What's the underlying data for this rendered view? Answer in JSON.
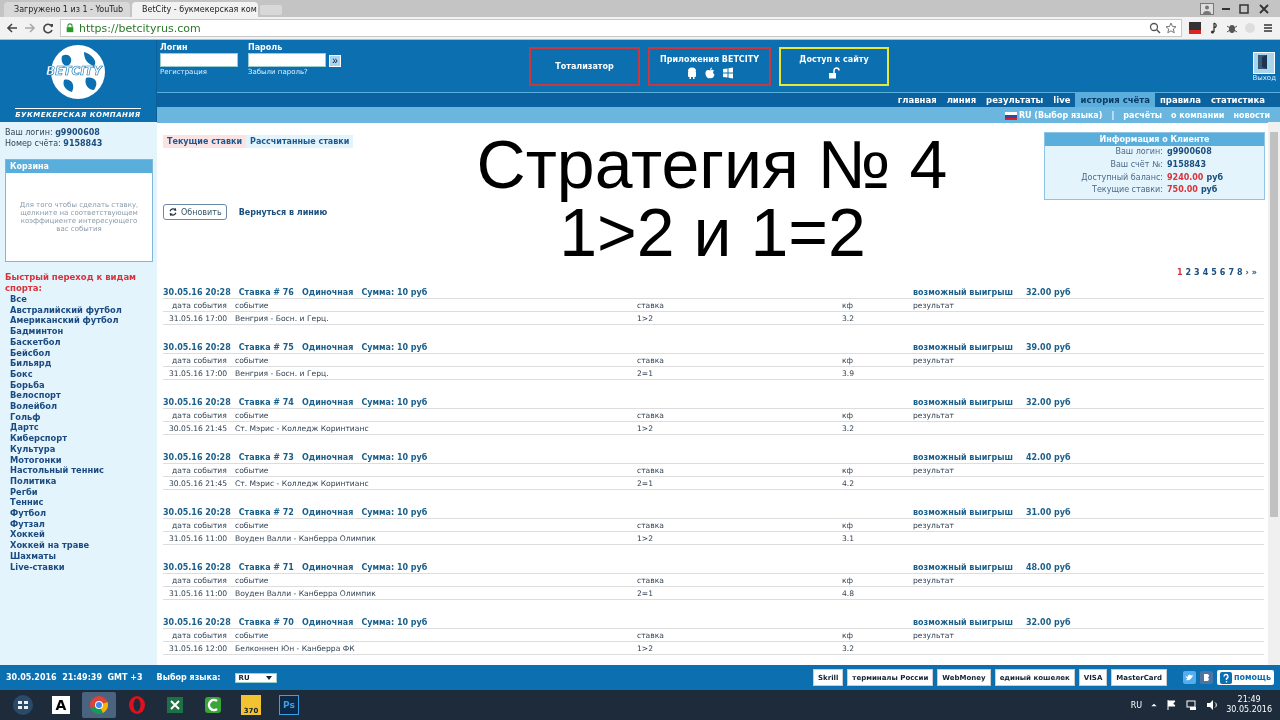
{
  "browser": {
    "tabs": [
      {
        "title": "Загружено 1 из 1 - YouTub",
        "selected": false
      },
      {
        "title": "BetCity - букмекерская ком",
        "selected": true
      }
    ],
    "url": "https://betcityrus.com"
  },
  "header": {
    "logo": {
      "name": "BETCITY",
      "tagline": "БУКМЕКЕРСКАЯ КОМПАНИЯ"
    },
    "login": {
      "label": "Логин",
      "link": "Регистрация"
    },
    "password": {
      "label": "Пароль",
      "link": "Забыли пароль?"
    },
    "submit": "»",
    "promo": [
      {
        "kind": "plain",
        "title": "Тотализатор",
        "color": "#c8383e"
      },
      {
        "kind": "apps",
        "title": "Приложения BETCITY",
        "color": "#c8383e"
      },
      {
        "kind": "lock",
        "title": "Доступ к сайту",
        "color": "#e8e83a"
      }
    ],
    "exit": "Выход"
  },
  "nav": [
    {
      "label": "главная",
      "selected": false
    },
    {
      "label": "линия",
      "selected": false
    },
    {
      "label": "результаты",
      "selected": false
    },
    {
      "label": "live",
      "selected": false
    },
    {
      "label": "история счёта",
      "selected": true
    },
    {
      "label": "правила",
      "selected": false
    },
    {
      "label": "статистика",
      "selected": false
    }
  ],
  "subnav": {
    "language": "RU (Выбор языка)",
    "separator": "|",
    "links": [
      "расчёты",
      "о компании",
      "новости"
    ]
  },
  "account": {
    "login_label": "Ваш логин:",
    "login": "g9900608",
    "number_label": "Номер счёта:",
    "number": "9158843"
  },
  "basket": {
    "title": "Корзина",
    "hint": "Для того чтобы сделать ставку, щелкните на соответствующем коэффициенте интересующего вас события"
  },
  "sports": {
    "heading": "Быстрый переход к видам спорта:",
    "items": [
      "Все",
      "Австралийский футбол",
      "Американский футбол",
      "Бадминтон",
      "Баскетбол",
      "Бейсбол",
      "Бильярд",
      "Бокс",
      "Борьба",
      "Велоспорт",
      "Волейбол",
      "Гольф",
      "Дартс",
      "Киберспорт",
      "Культура",
      "Мотогонки",
      "Настольный теннис",
      "Политика",
      "Регби",
      "Теннис",
      "Футбол",
      "Футзал",
      "Хоккей",
      "Хоккей на траве",
      "Шахматы",
      "Live-ставки"
    ]
  },
  "bet_tabs": [
    {
      "label": "Текущие ставки",
      "selected": true
    },
    {
      "label": "Рассчитанные ставки",
      "selected": false
    }
  ],
  "refresh": "Обновить",
  "back_link": "Вернуться в линию",
  "overlay": [
    "Стратегия № 4",
    "1>2 и 1=2"
  ],
  "client_info": {
    "title": "Информация о Клиенте",
    "rows": [
      {
        "label": "Ваш логин:",
        "value": "g9900608"
      },
      {
        "label": "Ваш счёт №:",
        "value": "9158843"
      },
      {
        "label": "Доступный баланс:",
        "value": "9240.00",
        "unit": "руб"
      },
      {
        "label": "Текущие ставки:",
        "value": "750.00",
        "unit": "руб"
      }
    ]
  },
  "pagination": [
    {
      "label": "1",
      "selected": true
    },
    {
      "label": "2",
      "selected": false
    },
    {
      "label": "3",
      "selected": false
    },
    {
      "label": "4",
      "selected": false
    },
    {
      "label": "5",
      "selected": false
    },
    {
      "label": "6",
      "selected": false
    },
    {
      "label": "7",
      "selected": false
    },
    {
      "label": "8",
      "selected": false
    },
    {
      "label": "›",
      "selected": false
    },
    {
      "label": "»",
      "selected": false
    }
  ],
  "bets": [
    {
      "placed": "30.05.16 20:28",
      "number": "Ставка # 76",
      "type": "Одиночная",
      "sum": "Сумма: 10 руб",
      "win_label": "возможный выигрыш",
      "win": "32.00 руб",
      "columns": [
        "дата события",
        "событие",
        "ставка",
        "кф",
        "результат"
      ],
      "event_date": "31.05.16 17:00",
      "event": "Венгрия - Босн. и Герц.",
      "pick": "1>2",
      "odds": "3.2"
    },
    {
      "placed": "30.05.16 20:28",
      "number": "Ставка # 75",
      "type": "Одиночная",
      "sum": "Сумма: 10 руб",
      "win_label": "возможный выигрыш",
      "win": "39.00 руб",
      "columns": [
        "дата события",
        "событие",
        "ставка",
        "кф",
        "результат"
      ],
      "event_date": "31.05.16 17:00",
      "event": "Венгрия - Босн. и Герц.",
      "pick": "2=1",
      "odds": "3.9"
    },
    {
      "placed": "30.05.16 20:28",
      "number": "Ставка # 74",
      "type": "Одиночная",
      "sum": "Сумма: 10 руб",
      "win_label": "возможный выигрыш",
      "win": "32.00 руб",
      "columns": [
        "дата события",
        "событие",
        "ставка",
        "кф",
        "результат"
      ],
      "event_date": "30.05.16 21:45",
      "event": "Ст. Мэрис - Колледж Коринтианс",
      "pick": "1>2",
      "odds": "3.2"
    },
    {
      "placed": "30.05.16 20:28",
      "number": "Ставка # 73",
      "type": "Одиночная",
      "sum": "Сумма: 10 руб",
      "win_label": "возможный выигрыш",
      "win": "42.00 руб",
      "columns": [
        "дата события",
        "событие",
        "ставка",
        "кф",
        "результат"
      ],
      "event_date": "30.05.16 21:45",
      "event": "Ст. Мэрис - Колледж Коринтианс",
      "pick": "2=1",
      "odds": "4.2"
    },
    {
      "placed": "30.05.16 20:28",
      "number": "Ставка # 72",
      "type": "Одиночная",
      "sum": "Сумма: 10 руб",
      "win_label": "возможный выигрыш",
      "win": "31.00 руб",
      "columns": [
        "дата события",
        "событие",
        "ставка",
        "кф",
        "результат"
      ],
      "event_date": "31.05.16 11:00",
      "event": "Воуден Валли - Канберра Олимпик",
      "pick": "1>2",
      "odds": "3.1"
    },
    {
      "placed": "30.05.16 20:28",
      "number": "Ставка # 71",
      "type": "Одиночная",
      "sum": "Сумма: 10 руб",
      "win_label": "возможный выигрыш",
      "win": "48.00 руб",
      "columns": [
        "дата события",
        "событие",
        "ставка",
        "кф",
        "результат"
      ],
      "event_date": "31.05.16 11:00",
      "event": "Воуден Валли - Канберра Олимпик",
      "pick": "2=1",
      "odds": "4.8"
    },
    {
      "placed": "30.05.16 20:28",
      "number": "Ставка # 70",
      "type": "Одиночная",
      "sum": "Сумма: 10 руб",
      "win_label": "возможный выигрыш",
      "win": "32.00 руб",
      "columns": [
        "дата события",
        "событие",
        "ставка",
        "кф",
        "результат"
      ],
      "event_date": "31.05.16 12:00",
      "event": "Белконнен Юн - Канберра ФК",
      "pick": "1>2",
      "odds": "3.2"
    }
  ],
  "footer": {
    "datetime": "30.05.2016  21:49:39  GMT +3",
    "language_label": "Выбор языка:",
    "language": "RU",
    "payments": [
      "Skrill",
      "терминалы России",
      "WebMoney",
      "единый кошелек",
      "VISA",
      "MasterCard"
    ],
    "help": "помощь"
  },
  "taskbar": {
    "apps": [
      {
        "kind": "letter",
        "glyph": "A",
        "selected": false
      },
      {
        "kind": "chrome",
        "selected": true
      },
      {
        "kind": "opera",
        "selected": false
      },
      {
        "kind": "excel",
        "selected": false
      },
      {
        "kind": "camtasia",
        "selected": false
      },
      {
        "kind": "clapper",
        "glyph": "370",
        "selected": false
      },
      {
        "kind": "ps",
        "glyph": "Ps",
        "selected": false
      }
    ],
    "lang": "RU",
    "time": "21:49",
    "date": "30.05.2016"
  }
}
